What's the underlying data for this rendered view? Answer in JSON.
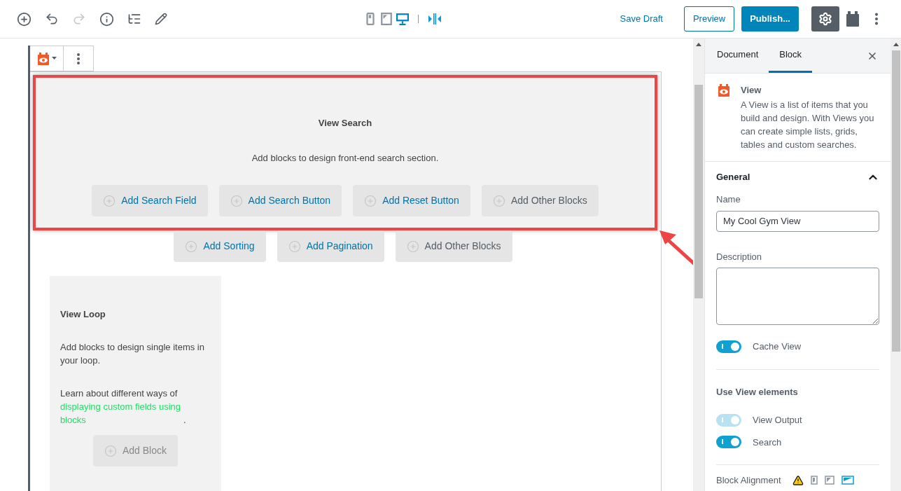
{
  "toolbar": {
    "devices": [
      {
        "kind": "mobile",
        "selected": false
      },
      {
        "kind": "tablet",
        "selected": false
      },
      {
        "kind": "desktop",
        "selected": true
      }
    ],
    "save_draft": "Save Draft",
    "preview": "Preview",
    "publish": "Publish...",
    "settings_on": true
  },
  "view_search": {
    "highlighted": true,
    "title": "View Search",
    "description": "Add blocks to design front-end search section.",
    "buttons": [
      {
        "label": "Add Search Field",
        "kind": "primary"
      },
      {
        "label": "Add Search Button",
        "kind": "primary"
      },
      {
        "label": "Add Reset Button",
        "kind": "primary"
      },
      {
        "label": "Add Other Blocks",
        "kind": "other"
      }
    ]
  },
  "pagination_buttons": [
    {
      "label": "Add Sorting",
      "kind": "primary"
    },
    {
      "label": "Add Pagination",
      "kind": "primary"
    },
    {
      "label": "Add Other Blocks",
      "kind": "other"
    }
  ],
  "view_loop": {
    "title": "View Loop",
    "description": "Add blocks to design single items in your loop.",
    "learn_text": "Learn about different ways of",
    "link": "displaying custom fields using blocks",
    "after_link": ".",
    "button": "Add Block"
  },
  "sidebar": {
    "tabs": [
      {
        "label": "Document",
        "selected": false
      },
      {
        "label": "Block",
        "selected": true
      }
    ],
    "block_title": "View",
    "block_description": "A View is a list of items that you build and design. With Views you can create simple lists, grids, tables and custom searches.",
    "section_title": "General",
    "expanded": true,
    "name_label": "Name",
    "name_value": "My Cool Gym View",
    "description_label": "Description",
    "cache_toggle": {
      "label": "Cache View",
      "on": true,
      "disabled": false
    },
    "elements_title": "Use View elements",
    "element_toggles": [
      {
        "label": "View Output",
        "on": true,
        "disabled": true
      },
      {
        "label": "Search",
        "on": true,
        "disabled": false
      }
    ],
    "alignment_label": "Block Alignment",
    "alignments": [
      {
        "kind": "left",
        "selected": false
      },
      {
        "kind": "center",
        "selected": false
      },
      {
        "kind": "wide",
        "selected": true
      }
    ]
  }
}
